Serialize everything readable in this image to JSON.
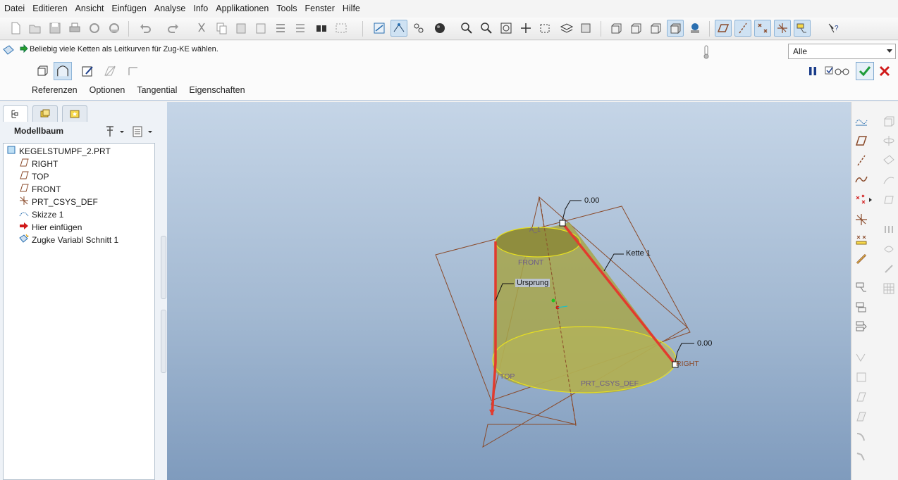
{
  "menu": [
    "Datei",
    "Editieren",
    "Ansicht",
    "Einfügen",
    "Analyse",
    "Info",
    "Applikationen",
    "Tools",
    "Fenster",
    "Hilfe"
  ],
  "toolbar": {
    "icons": [
      "new-file-icon",
      "open-icon",
      "save-icon",
      "print-icon",
      "save-copy-icon",
      "send-icon",
      "undo-icon",
      "redo-icon",
      "cut-icon",
      "copy-icon",
      "paste-icon",
      "paste-special-icon",
      "regenerate-icon",
      "manager-icon",
      "find-icon",
      "select-box-icon",
      "view-manager-icon",
      "datum-display-icon",
      "axis-display-icon",
      "point-display-icon",
      "shade-icon",
      "zoom-in-icon",
      "zoom-out-icon",
      "refit-icon",
      "reorient-icon",
      "saved-views-icon",
      "layers-icon",
      "appearance-icon",
      "wireframe-icon",
      "hidden-line-icon",
      "no-hidden-icon",
      "shading-icon",
      "enhanced-realism-icon",
      "plane-display-icon",
      "axis-tag-icon",
      "point-tag-icon",
      "csys-tag-icon",
      "annotation-icon",
      "context-help-icon"
    ]
  },
  "dashboard": {
    "message": "Beliebig viele Ketten als Leitkurven für Zug-KE wählen.",
    "filter_value": "Alle",
    "tabs": [
      "Referenzen",
      "Optionen",
      "Tangential",
      "Eigenschaften"
    ]
  },
  "model_tree": {
    "header": "Modellbaum",
    "items": [
      {
        "label": "KEGELSTUMPF_2.PRT",
        "icon": "part-icon"
      },
      {
        "label": "RIGHT",
        "icon": "datum-plane-icon"
      },
      {
        "label": "TOP",
        "icon": "datum-plane-icon"
      },
      {
        "label": "FRONT",
        "icon": "datum-plane-icon"
      },
      {
        "label": "PRT_CSYS_DEF",
        "icon": "csys-icon"
      },
      {
        "label": "Skizze 1",
        "icon": "sketch-icon"
      },
      {
        "label": "Hier einfügen",
        "icon": "insert-arrow-icon"
      },
      {
        "label": "Zugke Variabl Schnitt 1",
        "icon": "sweep-icon"
      }
    ]
  },
  "viewport": {
    "dim_top": "0.00",
    "dim_right": "0.00",
    "chain_label": "Kette 1",
    "origin_label": "Ursprung",
    "plane_front": "FRONT",
    "plane_top": "TOP",
    "plane_right": "RIGHT",
    "csys_label": "PRT_CSYS_DEF",
    "axis_label": "A_1"
  },
  "colors": {
    "cone_fill": "#a6a54a",
    "cone_edge": "#e8e020",
    "chain_red": "#e23b2e",
    "datum_brown": "#8a4a2a",
    "accept_green": "#1f9c3a",
    "cancel_red": "#d01a1a"
  }
}
